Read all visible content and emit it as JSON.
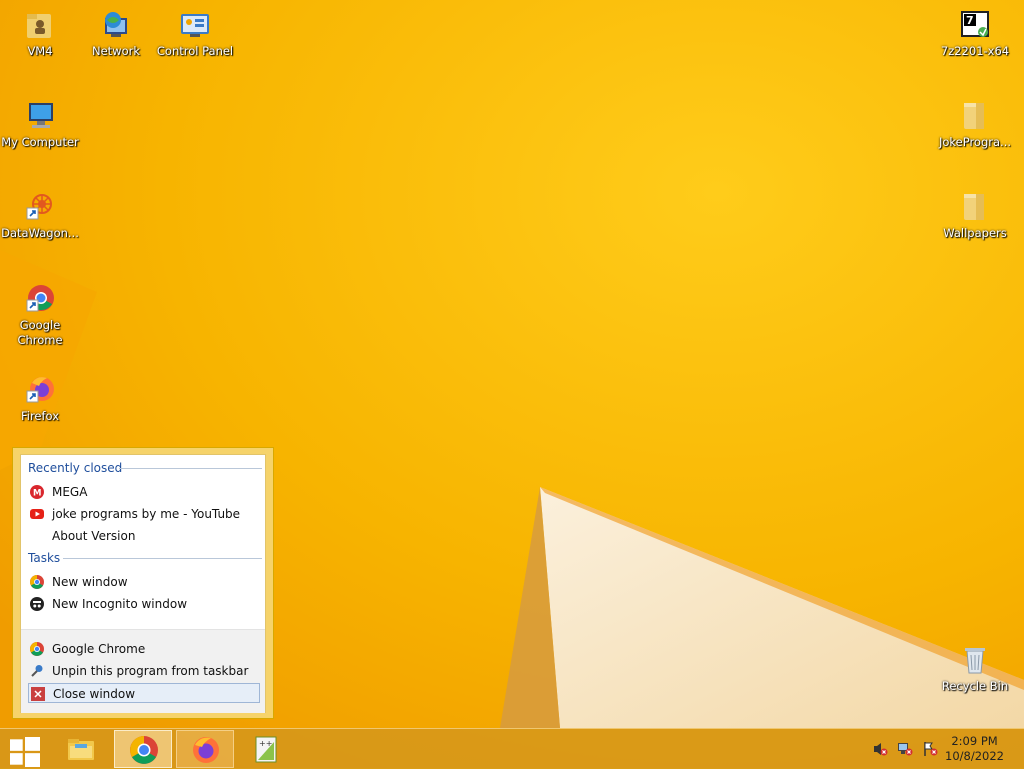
{
  "desktop": {
    "icons_left": [
      {
        "label": "VM4",
        "icon": "folder-user-icon"
      },
      {
        "label": "Network",
        "icon": "network-globe-icon"
      },
      {
        "label": "Control Panel",
        "icon": "control-panel-icon"
      },
      {
        "label": "My Computer",
        "icon": "computer-icon"
      },
      {
        "label": "DataWagon...",
        "icon": "datawagon-shortcut-icon"
      },
      {
        "label": "Google Chrome",
        "icon": "chrome-shortcut-icon"
      },
      {
        "label": "Firefox",
        "icon": "firefox-shortcut-icon"
      }
    ],
    "icons_right": [
      {
        "label": "7z2201-x64",
        "icon": "7zip-installer-icon"
      },
      {
        "label": "JokeProgra...",
        "icon": "folder-icon"
      },
      {
        "label": "Wallpapers",
        "icon": "folder-icon"
      },
      {
        "label": "Recycle Bin",
        "icon": "recycle-bin-icon"
      }
    ]
  },
  "jumplist": {
    "recent_title": "Recently closed",
    "recent": [
      {
        "label": "MEGA",
        "icon": "mega-icon"
      },
      {
        "label": "joke programs by me - YouTube",
        "icon": "youtube-icon"
      },
      {
        "label": "About Version",
        "icon": ""
      }
    ],
    "tasks_title": "Tasks",
    "tasks": [
      {
        "label": "New window",
        "icon": "chrome-icon"
      },
      {
        "label": "New Incognito window",
        "icon": "incognito-icon"
      }
    ],
    "bottom": [
      {
        "label": "Google Chrome",
        "icon": "chrome-icon"
      },
      {
        "label": "Unpin this program from taskbar",
        "icon": "unpin-icon"
      },
      {
        "label": "Close window",
        "icon": "close-icon"
      }
    ]
  },
  "taskbar": {
    "items": [
      "start-button",
      "file-explorer",
      "google-chrome",
      "firefox",
      "notepad-plus-plus"
    ],
    "clock_time": "2:09 PM",
    "clock_date": "10/8/2022"
  },
  "colors": {
    "wallpaper": "#f5b700",
    "accent": "#1f4e9c"
  }
}
